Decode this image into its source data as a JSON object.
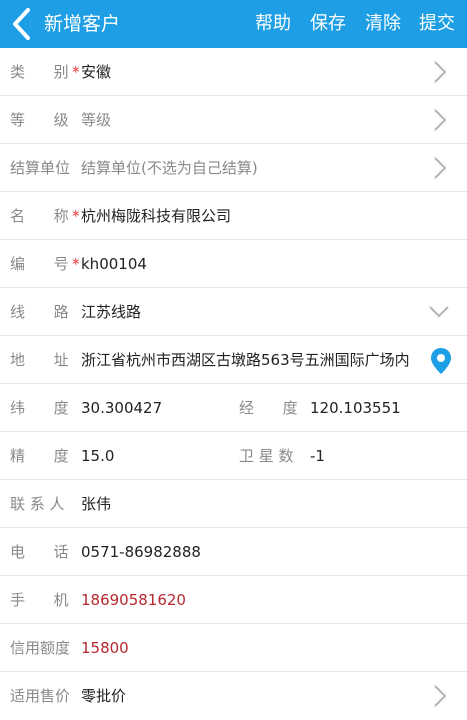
{
  "header": {
    "title": "新增客户",
    "actions": {
      "help": "帮助",
      "save": "保存",
      "clear": "清除",
      "submit": "提交"
    }
  },
  "form": {
    "category": {
      "label": "类      别",
      "required": "*",
      "value": "安徽"
    },
    "level": {
      "label": "等      级",
      "placeholder": "等级"
    },
    "settlement": {
      "label": "结算单位",
      "placeholder": "结算单位(不选为自己结算)"
    },
    "name": {
      "label": "名      称",
      "required": "*",
      "value": "杭州梅陇科技有限公司"
    },
    "code": {
      "label": "编      号",
      "required": "*",
      "value": "kh00104"
    },
    "route": {
      "label": "线      路",
      "value": "江苏线路"
    },
    "address": {
      "label": "地      址",
      "value": "浙江省杭州市西湖区古墩路563号五洲国际广场内"
    },
    "latitude": {
      "label": "纬      度",
      "value": "30.300427"
    },
    "longitude": {
      "label": "经      度",
      "value": "120.103551"
    },
    "precision": {
      "label": "精      度",
      "value": "15.0"
    },
    "satellites": {
      "label": "卫 星 数",
      "value": "-1"
    },
    "contact": {
      "label": "联 系 人",
      "value": "张伟"
    },
    "phone": {
      "label": "电      话",
      "value": "0571-86982888"
    },
    "mobile": {
      "label": "手      机",
      "value": "18690581620"
    },
    "credit": {
      "label": "信用额度",
      "value": "15800"
    },
    "price": {
      "label": "适用售价",
      "value": "零批价"
    }
  },
  "colors": {
    "header_bg": "#1e9fe5",
    "required": "#e03030",
    "highlight_value": "#b7282e",
    "pin": "#1e9fe5"
  },
  "icons": {
    "back": "chevron-left-icon",
    "more": "chevron-right-icon",
    "dropdown": "chevron-down-icon",
    "location": "location-pin-icon"
  }
}
